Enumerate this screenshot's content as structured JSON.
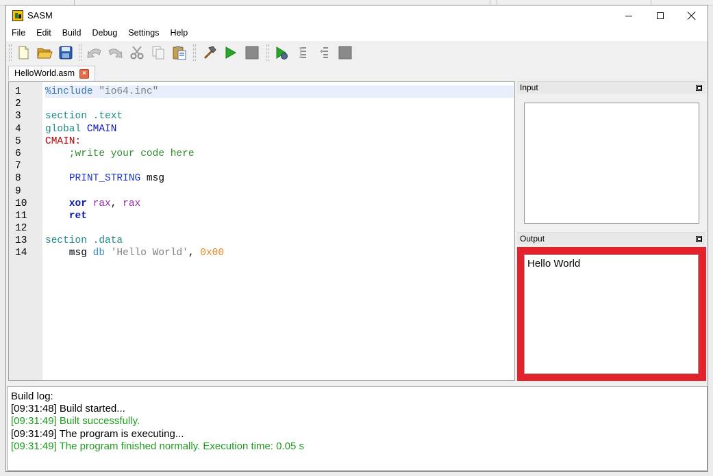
{
  "window": {
    "title": "SASM"
  },
  "menu": [
    "File",
    "Edit",
    "Build",
    "Debug",
    "Settings",
    "Help"
  ],
  "toolbar": {
    "icons": [
      "new-file-icon",
      "open-folder-icon",
      "save-icon",
      "undo-icon",
      "redo-icon",
      "cut-icon",
      "copy-icon",
      "paste-icon",
      "build-hammer-icon",
      "run-icon",
      "stop-icon",
      "debug-icon",
      "step-over-icon",
      "step-into-icon",
      "debug-stop-icon"
    ]
  },
  "tab": {
    "label": "HelloWorld.asm"
  },
  "editor": {
    "line_numbers": [
      "1",
      "2",
      "3",
      "4",
      "5",
      "6",
      "7",
      "8",
      "9",
      "10",
      "11",
      "12",
      "13",
      "14"
    ],
    "lines": [
      [
        {
          "t": "%include ",
          "c": "inc"
        },
        {
          "t": "\"io64.inc\"",
          "c": "str"
        }
      ],
      [],
      [
        {
          "t": "section .text",
          "c": "sec"
        }
      ],
      [
        {
          "t": "global ",
          "c": "sec"
        },
        {
          "t": "CMAIN",
          "c": "kw"
        }
      ],
      [
        {
          "t": "CMAIN:",
          "c": "lbl"
        }
      ],
      [
        {
          "t": "    ;write your code here",
          "c": "cmt"
        }
      ],
      [],
      [
        {
          "t": "    ",
          "c": "pun"
        },
        {
          "t": "PRINT_STRING",
          "c": "mac"
        },
        {
          "t": " msg",
          "c": "pun"
        }
      ],
      [],
      [
        {
          "t": "    ",
          "c": "pun"
        },
        {
          "t": "xor",
          "c": "ins"
        },
        {
          "t": " ",
          "c": "pun"
        },
        {
          "t": "rax",
          "c": "reg"
        },
        {
          "t": ", ",
          "c": "pun"
        },
        {
          "t": "rax",
          "c": "reg"
        }
      ],
      [
        {
          "t": "    ",
          "c": "pun"
        },
        {
          "t": "ret",
          "c": "ins"
        }
      ],
      [],
      [
        {
          "t": "section .data",
          "c": "sec"
        }
      ],
      [
        {
          "t": "    msg ",
          "c": "pun"
        },
        {
          "t": "db",
          "c": "dir"
        },
        {
          "t": " ",
          "c": "pun"
        },
        {
          "t": "'Hello World'",
          "c": "str"
        },
        {
          "t": ", ",
          "c": "pun"
        },
        {
          "t": "0x00",
          "c": "num"
        }
      ]
    ],
    "current_line": 1
  },
  "input_panel": {
    "title": "Input",
    "value": ""
  },
  "output_panel": {
    "title": "Output",
    "value": "Hello World",
    "highlight_color": "#e3222b"
  },
  "build_log": {
    "lines": [
      {
        "text": "Build log:",
        "status": "normal"
      },
      {
        "text": "[09:31:48] Build started...",
        "status": "normal"
      },
      {
        "text": "[09:31:49] Built successfully.",
        "status": "success"
      },
      {
        "text": "[09:31:49] The program is executing...",
        "status": "normal"
      },
      {
        "text": "[09:31:49] The program finished normally. Execution time: 0.05 s",
        "status": "success"
      }
    ]
  }
}
